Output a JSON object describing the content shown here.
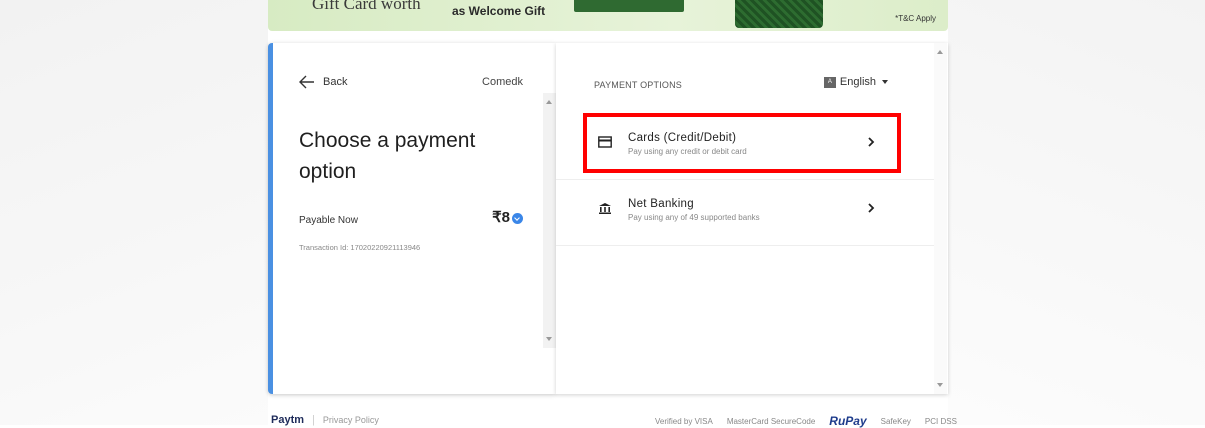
{
  "banner": {
    "text1": "Gift Card worth",
    "text2": "as Welcome Gift",
    "tc": "*T&C Apply"
  },
  "left": {
    "back_label": "Back",
    "merchant": "Comedk",
    "title": "Choose a payment option",
    "payable_label": "Payable Now",
    "amount": "₹8",
    "transaction": "Transaction Id: 17020220921113946"
  },
  "right": {
    "header": "PAYMENT OPTIONS",
    "language": "English",
    "options": [
      {
        "title": "Cards (Credit/Debit)",
        "subtitle": "Pay using any credit or debit card",
        "icon": "credit-card-icon"
      },
      {
        "title": "Net Banking",
        "subtitle": "Pay using any of 49 supported banks",
        "icon": "bank-icon"
      }
    ]
  },
  "footer": {
    "brand": "Paytm",
    "privacy": "Privacy Policy",
    "badges": [
      "Verified by VISA",
      "MasterCard SecureCode",
      "RuPay",
      "SafeKey",
      "PCI DSS"
    ]
  },
  "colors": {
    "accent": "#4a90e2",
    "highlight": "#ff0000"
  }
}
